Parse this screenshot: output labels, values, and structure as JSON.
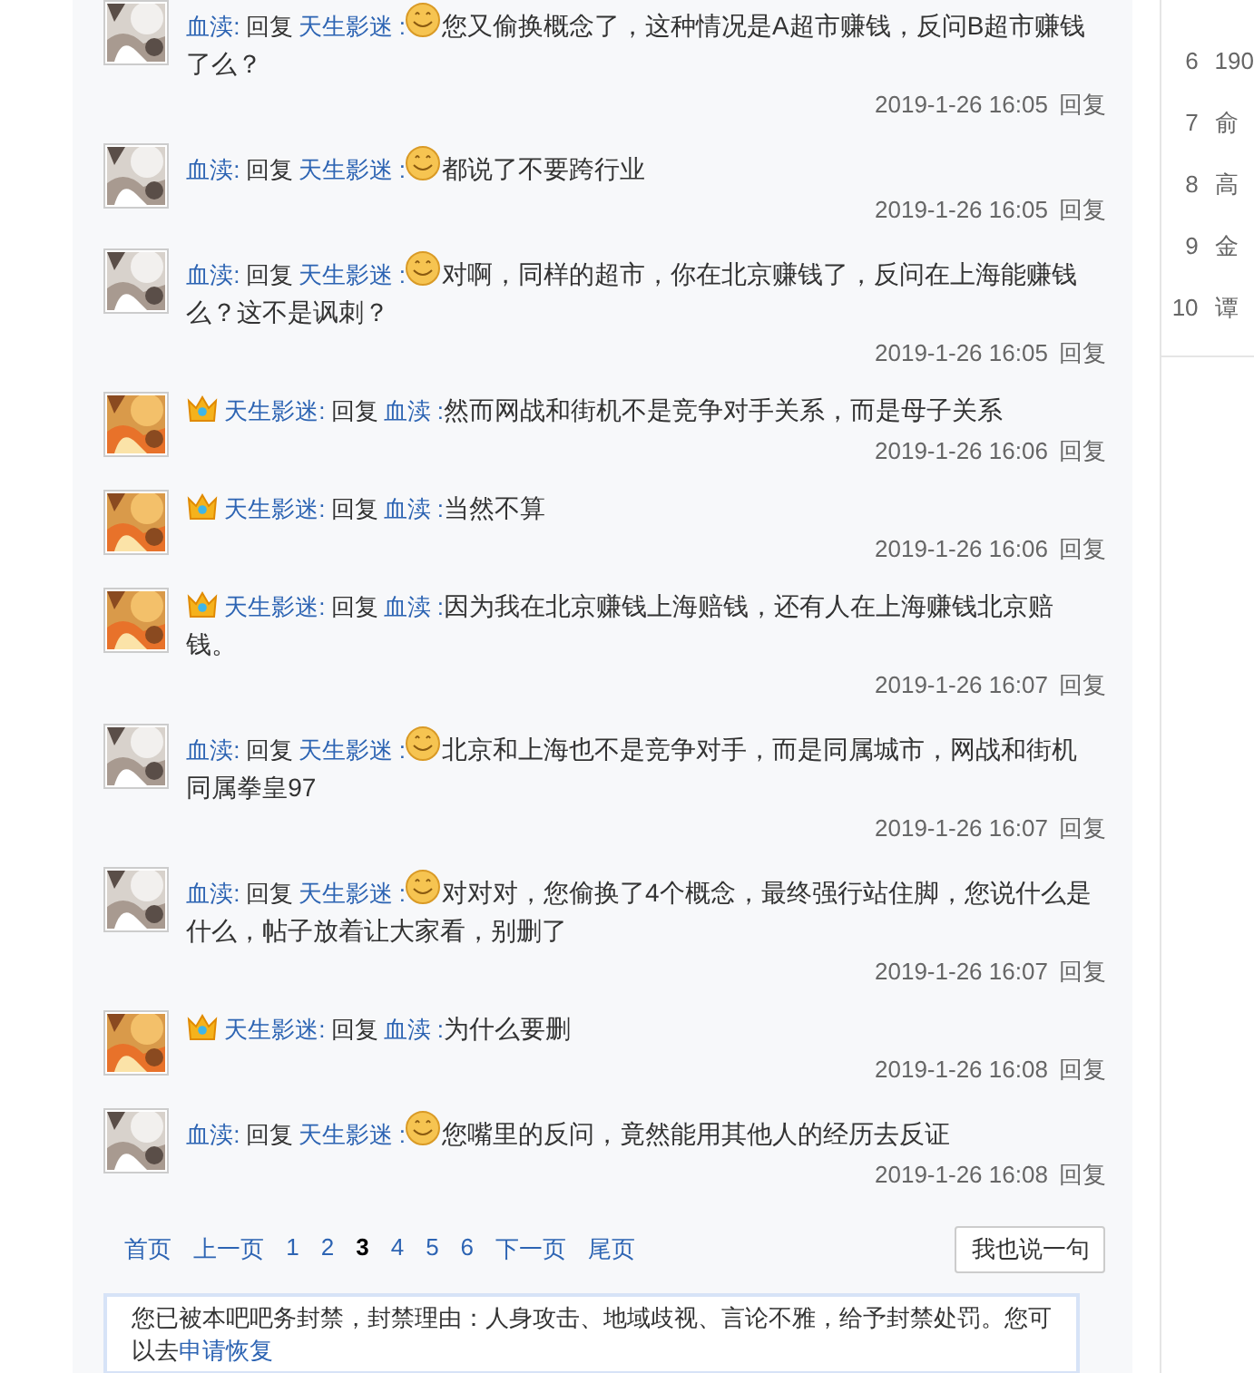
{
  "comments": [
    {
      "author": "血渎:",
      "vip": false,
      "verb": "回复",
      "target": "天生影迷 :",
      "emoji": true,
      "text": "您又偷换概念了，这种情况是A超市赚钱，反问B超市赚钱了么？",
      "time": "2019-1-26 16:05",
      "reply": "回复"
    },
    {
      "author": "血渎:",
      "vip": false,
      "verb": "回复",
      "target": "天生影迷 :",
      "emoji": true,
      "text": "都说了不要跨行业",
      "time": "2019-1-26 16:05",
      "reply": "回复"
    },
    {
      "author": "血渎:",
      "vip": false,
      "verb": "回复",
      "target": "天生影迷 :",
      "emoji": true,
      "text": "对啊，同样的超市，你在北京赚钱了，反问在上海能赚钱么？这不是讽刺？",
      "time": "2019-1-26 16:05",
      "reply": "回复"
    },
    {
      "author": "天生影迷:",
      "vip": true,
      "verb": "回复",
      "target": "血渎 :",
      "emoji": false,
      "text": "然而网战和街机不是竞争对手关系，而是母子关系",
      "time": "2019-1-26 16:06",
      "reply": "回复"
    },
    {
      "author": "天生影迷:",
      "vip": true,
      "verb": "回复",
      "target": "血渎 :",
      "emoji": false,
      "text": "当然不算",
      "time": "2019-1-26 16:06",
      "reply": "回复"
    },
    {
      "author": "天生影迷:",
      "vip": true,
      "verb": "回复",
      "target": "血渎 :",
      "emoji": false,
      "text": "因为我在北京赚钱上海赔钱，还有人在上海赚钱北京赔钱。",
      "time": "2019-1-26 16:07",
      "reply": "回复"
    },
    {
      "author": "血渎:",
      "vip": false,
      "verb": "回复",
      "target": "天生影迷 :",
      "emoji": true,
      "text": "北京和上海也不是竞争对手，而是同属城市，网战和街机同属拳皇97",
      "time": "2019-1-26 16:07",
      "reply": "回复"
    },
    {
      "author": "血渎:",
      "vip": false,
      "verb": "回复",
      "target": "天生影迷 :",
      "emoji": true,
      "text": "对对对，您偷换了4个概念，最终强行站住脚，您说什么是什么，帖子放着让大家看，别删了",
      "time": "2019-1-26 16:07",
      "reply": "回复"
    },
    {
      "author": "天生影迷:",
      "vip": true,
      "verb": "回复",
      "target": "血渎 :",
      "emoji": false,
      "text": "为什么要删",
      "time": "2019-1-26 16:08",
      "reply": "回复"
    },
    {
      "author": "血渎:",
      "vip": false,
      "verb": "回复",
      "target": "天生影迷 :",
      "emoji": true,
      "text": "您嘴里的反问，竟然能用其他人的经历去反证",
      "time": "2019-1-26 16:08",
      "reply": "回复"
    }
  ],
  "pagination": [
    {
      "label": "首页",
      "selected": false
    },
    {
      "label": "上一页",
      "selected": false
    },
    {
      "label": "1",
      "selected": false
    },
    {
      "label": "2",
      "selected": false
    },
    {
      "label": "3",
      "selected": true
    },
    {
      "label": "4",
      "selected": false
    },
    {
      "label": "5",
      "selected": false
    },
    {
      "label": "6",
      "selected": false
    },
    {
      "label": "下一页",
      "selected": false
    },
    {
      "label": "尾页",
      "selected": false
    }
  ],
  "comment_button": "我也说一句",
  "notice": {
    "text": "您已被本吧吧务封禁，封禁理由：人身攻击、地域歧视、言论不雅，给予封禁处罚。您可以去",
    "link": "申请恢复"
  },
  "ranking": [
    {
      "rank": "6",
      "title": "190"
    },
    {
      "rank": "7",
      "title": "俞"
    },
    {
      "rank": "8",
      "title": "高"
    },
    {
      "rank": "9",
      "title": "金"
    },
    {
      "rank": "10",
      "title": "谭"
    }
  ]
}
